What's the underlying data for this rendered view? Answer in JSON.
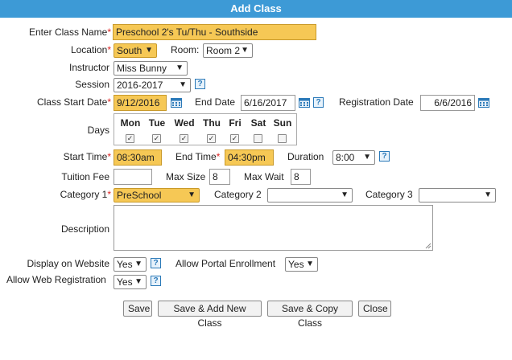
{
  "dialog": {
    "title": "Add Class"
  },
  "fields": {
    "class_name": {
      "label": "Enter Class Name",
      "value": "Preschool 2's Tu/Thu - Southside"
    },
    "location": {
      "label": "Location",
      "value": "South"
    },
    "room": {
      "label": "Room:",
      "value": "Room 2"
    },
    "instructor": {
      "label": "Instructor",
      "value": "Miss Bunny"
    },
    "session": {
      "label": "Session",
      "value": "2016-2017"
    },
    "start_date": {
      "label": "Class Start Date",
      "value": "9/12/2016"
    },
    "end_date": {
      "label": "End Date",
      "value": "6/16/2017"
    },
    "registration_date": {
      "label": "Registration Date",
      "value": "6/6/2016"
    },
    "days": {
      "label": "Days",
      "items": [
        {
          "name": "Mon",
          "checked": "✓"
        },
        {
          "name": "Tue",
          "checked": "✓"
        },
        {
          "name": "Wed",
          "checked": "✓"
        },
        {
          "name": "Thu",
          "checked": "✓"
        },
        {
          "name": "Fri",
          "checked": "✓"
        },
        {
          "name": "Sat",
          "checked": ""
        },
        {
          "name": "Sun",
          "checked": ""
        }
      ]
    },
    "start_time": {
      "label": "Start Time",
      "value": "08:30am"
    },
    "end_time": {
      "label": "End Time",
      "value": "04:30pm"
    },
    "duration": {
      "label": "Duration",
      "value": "8:00"
    },
    "tuition_fee": {
      "label": "Tuition Fee",
      "value": ""
    },
    "max_size": {
      "label": "Max Size",
      "value": "8"
    },
    "max_wait": {
      "label": "Max Wait",
      "value": "8"
    },
    "category1": {
      "label": "Category 1",
      "value": "PreSchool"
    },
    "category2": {
      "label": "Category 2",
      "value": ""
    },
    "category3": {
      "label": "Category 3",
      "value": ""
    },
    "description": {
      "label": "Description",
      "value": ""
    },
    "display_on_website": {
      "label": "Display on Website",
      "value": "Yes"
    },
    "allow_portal_enrollment": {
      "label": "Allow Portal Enrollment",
      "value": "Yes"
    },
    "allow_web_registration": {
      "label": "Allow Web Registration",
      "value": "Yes"
    }
  },
  "required_marker": "*",
  "help_glyph": "?",
  "dropdown_arrow": "▼",
  "buttons": {
    "save": "Save",
    "save_add_new": "Save & Add New Class",
    "save_copy": "Save & Copy Class",
    "close": "Close"
  },
  "colors": {
    "title_bar": "#3d9ad6",
    "highlight": "#f6c855",
    "required": "#dd2222",
    "help": "#2a79b8"
  },
  "icons": {
    "calendar": "calendar-icon",
    "help": "help-icon",
    "dropdown": "chevron-down-icon"
  }
}
